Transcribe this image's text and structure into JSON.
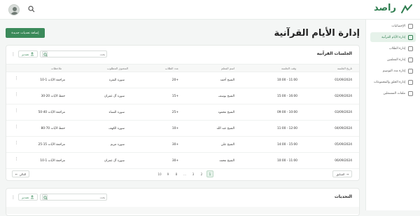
{
  "app": {
    "logo_text": "راصد"
  },
  "sidebar": {
    "items": [
      {
        "label": "الإحصائيات",
        "active": false
      },
      {
        "label": "إدارة الأيام القرآنية",
        "active": true
      },
      {
        "label": "إدارة الطلاب",
        "active": false
      },
      {
        "label": "إدارة المعلمين",
        "active": false
      },
      {
        "label": "إدارة مدد التوصيم",
        "active": false
      },
      {
        "label": "إدارة الحلق والمجموعات",
        "active": false
      },
      {
        "label": "ملفات المشتغلين",
        "active": false
      }
    ]
  },
  "header": {
    "title": "إدارة الأيام القرآنية",
    "add_button": "إضافة تحديات جديدة"
  },
  "sessions": {
    "title": "الجلسات القرآنية",
    "search_placeholder": "بحث",
    "export_label": "تصدير",
    "columns": [
      "تاريخ الجلسة",
      "وقت الجلسة",
      "اسم المعلم",
      "عدد الطلاب",
      "المحتوى المطلوب",
      "ملاحظات"
    ],
    "rows": [
      [
        "01/09/2024",
        "10:00 - 11:00",
        "الشيخ أحمد",
        "20+",
        "سورة البقرة",
        "مراجعة الآيات 1-10"
      ],
      [
        "02/09/2024",
        "15:00 - 16:00",
        "الشيخ يوسف",
        "15+",
        "سورة آل عمران",
        "حفظ الآيات 20-30"
      ],
      [
        "03/09/2024",
        "09:00 - 10:00",
        "الشيخ محمود",
        "25+",
        "سورة النساء",
        "مراجعة الآيات 40-50"
      ],
      [
        "04/09/2024",
        "11:00 - 12:00",
        "الشيخ عبد الله",
        "10+",
        "سورة الكهف",
        "حفظ الآيات 70-80"
      ],
      [
        "05/09/2024",
        "14:00 - 15:00",
        "الشيخ علي",
        "30+",
        "سورة مريم",
        "مراجعة الآيات 15-25"
      ],
      [
        "06/09/2024",
        "10:00 - 11:00",
        "الشيخ محمد",
        "30+",
        "سورة آل عمران",
        "مراجعة الآيات 1-10"
      ]
    ],
    "pagination": {
      "prev": "السابق",
      "next": "التالي",
      "pages": [
        "1",
        "2",
        "3",
        "...",
        "8",
        "9",
        "10"
      ],
      "current": "1"
    }
  },
  "challenges": {
    "title": "التحديات",
    "search_placeholder": "بحث",
    "export_label": "تصدير"
  }
}
